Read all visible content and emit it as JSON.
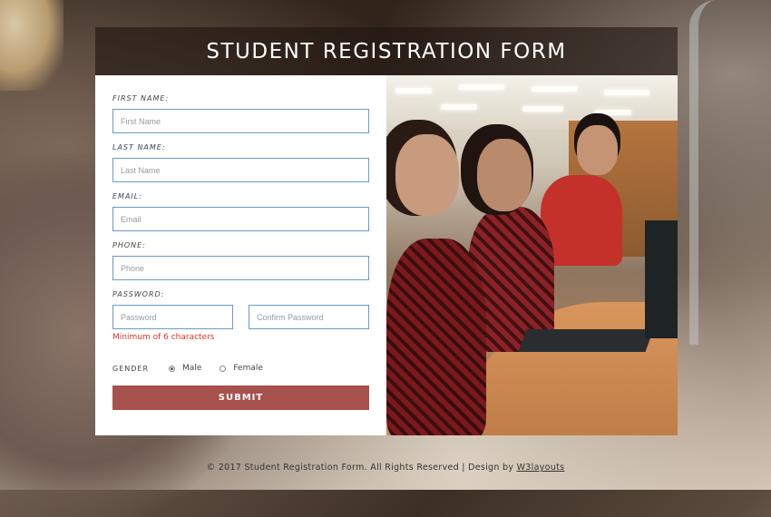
{
  "header": {
    "title": "STUDENT REGISTRATION FORM"
  },
  "form": {
    "first_name": {
      "label": "FIRST NAME:",
      "placeholder": "First Name",
      "value": ""
    },
    "last_name": {
      "label": "LAST NAME:",
      "placeholder": "Last Name",
      "value": ""
    },
    "email": {
      "label": "EMAIL:",
      "placeholder": "Email",
      "value": ""
    },
    "phone": {
      "label": "PHONE:",
      "placeholder": "Phone",
      "value": ""
    },
    "password": {
      "label": "PASSWORD:",
      "placeholder": "Password",
      "value": ""
    },
    "confirm_password": {
      "placeholder": "Confirm Password",
      "value": ""
    },
    "password_hint": "Minimum of 6 characters",
    "gender": {
      "label": "GENDER",
      "options": [
        "Male",
        "Female"
      ],
      "selected": "Male"
    },
    "submit_label": "SUBMIT"
  },
  "footer": {
    "text": "© 2017 Student Registration Form. All Rights Reserved | Design by ",
    "link_text": "W3layouts"
  },
  "colors": {
    "accent": "#a8524e",
    "input_border": "#6a9ac8",
    "hint": "#d9342b"
  },
  "icons": {
    "radio_selected": "radio-checked-icon",
    "radio_unselected": "radio-unchecked-icon"
  }
}
